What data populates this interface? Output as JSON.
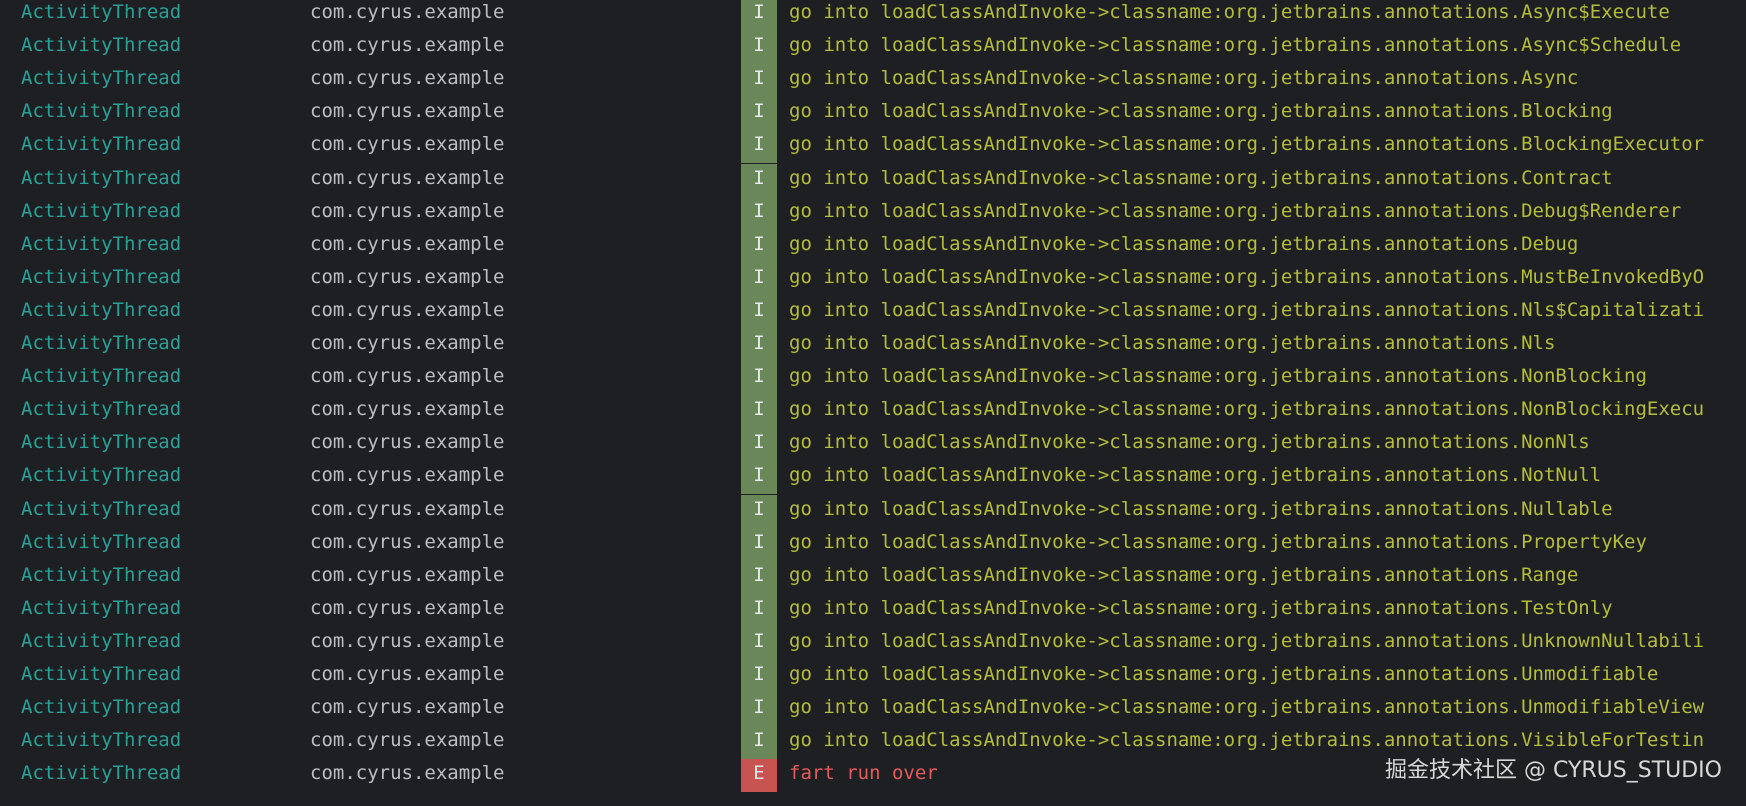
{
  "logcat": {
    "rows": [
      {
        "tag": "ActivityThread",
        "package": "com.cyrus.example",
        "level": "I",
        "message": "go into loadClassAndInvoke->classname:org.jetbrains.annotations.Async$Execute"
      },
      {
        "tag": "ActivityThread",
        "package": "com.cyrus.example",
        "level": "I",
        "message": "go into loadClassAndInvoke->classname:org.jetbrains.annotations.Async$Schedule"
      },
      {
        "tag": "ActivityThread",
        "package": "com.cyrus.example",
        "level": "I",
        "message": "go into loadClassAndInvoke->classname:org.jetbrains.annotations.Async"
      },
      {
        "tag": "ActivityThread",
        "package": "com.cyrus.example",
        "level": "I",
        "message": "go into loadClassAndInvoke->classname:org.jetbrains.annotations.Blocking"
      },
      {
        "tag": "ActivityThread",
        "package": "com.cyrus.example",
        "level": "I",
        "message": "go into loadClassAndInvoke->classname:org.jetbrains.annotations.BlockingExecutor"
      },
      {
        "tag": "ActivityThread",
        "package": "com.cyrus.example",
        "level": "I",
        "message": "go into loadClassAndInvoke->classname:org.jetbrains.annotations.Contract"
      },
      {
        "tag": "ActivityThread",
        "package": "com.cyrus.example",
        "level": "I",
        "message": "go into loadClassAndInvoke->classname:org.jetbrains.annotations.Debug$Renderer"
      },
      {
        "tag": "ActivityThread",
        "package": "com.cyrus.example",
        "level": "I",
        "message": "go into loadClassAndInvoke->classname:org.jetbrains.annotations.Debug"
      },
      {
        "tag": "ActivityThread",
        "package": "com.cyrus.example",
        "level": "I",
        "message": "go into loadClassAndInvoke->classname:org.jetbrains.annotations.MustBeInvokedByO"
      },
      {
        "tag": "ActivityThread",
        "package": "com.cyrus.example",
        "level": "I",
        "message": "go into loadClassAndInvoke->classname:org.jetbrains.annotations.Nls$Capitalizati"
      },
      {
        "tag": "ActivityThread",
        "package": "com.cyrus.example",
        "level": "I",
        "message": "go into loadClassAndInvoke->classname:org.jetbrains.annotations.Nls"
      },
      {
        "tag": "ActivityThread",
        "package": "com.cyrus.example",
        "level": "I",
        "message": "go into loadClassAndInvoke->classname:org.jetbrains.annotations.NonBlocking"
      },
      {
        "tag": "ActivityThread",
        "package": "com.cyrus.example",
        "level": "I",
        "message": "go into loadClassAndInvoke->classname:org.jetbrains.annotations.NonBlockingExecu"
      },
      {
        "tag": "ActivityThread",
        "package": "com.cyrus.example",
        "level": "I",
        "message": "go into loadClassAndInvoke->classname:org.jetbrains.annotations.NonNls"
      },
      {
        "tag": "ActivityThread",
        "package": "com.cyrus.example",
        "level": "I",
        "message": "go into loadClassAndInvoke->classname:org.jetbrains.annotations.NotNull"
      },
      {
        "tag": "ActivityThread",
        "package": "com.cyrus.example",
        "level": "I",
        "message": "go into loadClassAndInvoke->classname:org.jetbrains.annotations.Nullable"
      },
      {
        "tag": "ActivityThread",
        "package": "com.cyrus.example",
        "level": "I",
        "message": "go into loadClassAndInvoke->classname:org.jetbrains.annotations.PropertyKey"
      },
      {
        "tag": "ActivityThread",
        "package": "com.cyrus.example",
        "level": "I",
        "message": "go into loadClassAndInvoke->classname:org.jetbrains.annotations.Range"
      },
      {
        "tag": "ActivityThread",
        "package": "com.cyrus.example",
        "level": "I",
        "message": "go into loadClassAndInvoke->classname:org.jetbrains.annotations.TestOnly"
      },
      {
        "tag": "ActivityThread",
        "package": "com.cyrus.example",
        "level": "I",
        "message": "go into loadClassAndInvoke->classname:org.jetbrains.annotations.UnknownNullabili"
      },
      {
        "tag": "ActivityThread",
        "package": "com.cyrus.example",
        "level": "I",
        "message": "go into loadClassAndInvoke->classname:org.jetbrains.annotations.Unmodifiable"
      },
      {
        "tag": "ActivityThread",
        "package": "com.cyrus.example",
        "level": "I",
        "message": "go into loadClassAndInvoke->classname:org.jetbrains.annotations.UnmodifiableView"
      },
      {
        "tag": "ActivityThread",
        "package": "com.cyrus.example",
        "level": "I",
        "message": "go into loadClassAndInvoke->classname:org.jetbrains.annotations.VisibleForTestin"
      },
      {
        "tag": "ActivityThread",
        "package": "com.cyrus.example",
        "level": "E",
        "message": "fart run over"
      }
    ]
  },
  "watermark": "掘金技术社区 @ CYRUS_STUDIO",
  "colors": {
    "background": "#1e1f22",
    "tag_text": "#2aa198",
    "package_text": "#bcbec4",
    "info_badge": "#6a8759",
    "info_message": "#b5bd3a",
    "error_badge": "#c75450",
    "error_message": "#e55a5a"
  }
}
